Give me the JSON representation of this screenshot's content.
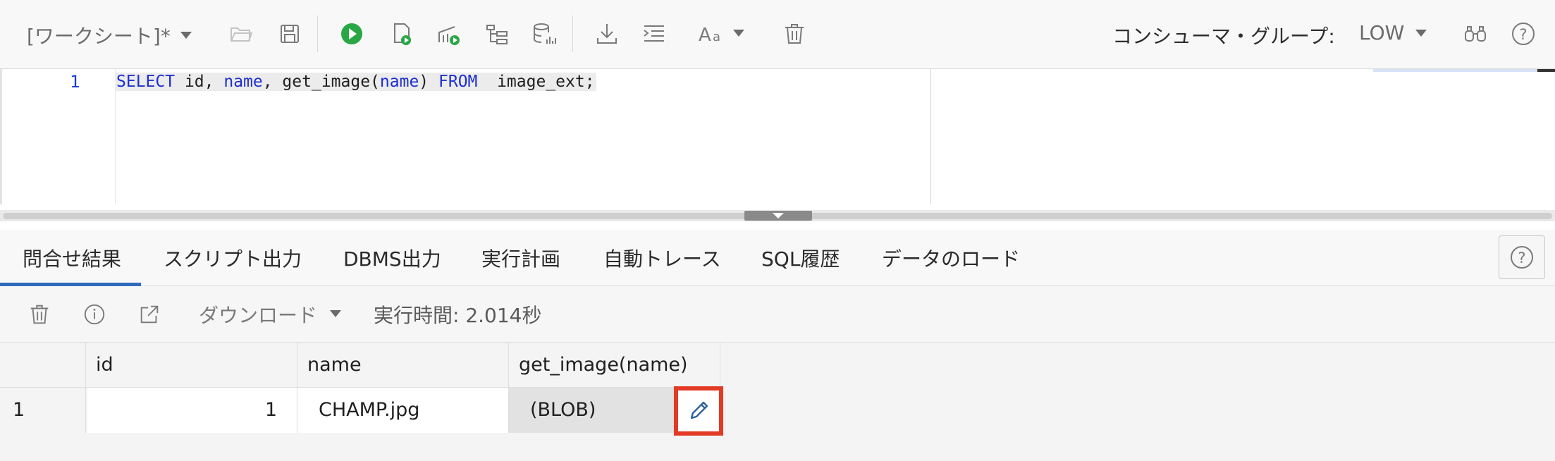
{
  "toolbar": {
    "worksheet_title": "[ワークシート]*",
    "consumer_group_label": "コンシューマ・グループ:",
    "consumer_group_value": "LOW",
    "colors": {
      "run_green": "#2aa745",
      "icon_gray": "#7a7a7a"
    }
  },
  "editor": {
    "line_number": "1",
    "tokens": [
      {
        "t": "SELECT",
        "kw": true
      },
      {
        "t": " id, ",
        "kw": false
      },
      {
        "t": "name",
        "kw": true
      },
      {
        "t": ", get_image(",
        "kw": false
      },
      {
        "t": "name",
        "kw": true
      },
      {
        "t": ") ",
        "kw": false
      },
      {
        "t": "FROM",
        "kw": true
      },
      {
        "t": "  image_ext;",
        "kw": false
      }
    ],
    "colors": {
      "keyword": "#1e2fd0"
    }
  },
  "tabs": [
    {
      "label": "問合せ結果",
      "active": true
    },
    {
      "label": "スクリプト出力",
      "active": false
    },
    {
      "label": "DBMS出力",
      "active": false
    },
    {
      "label": "実行計画",
      "active": false
    },
    {
      "label": "自動トレース",
      "active": false
    },
    {
      "label": "SQL履歴",
      "active": false
    },
    {
      "label": "データのロード",
      "active": false
    }
  ],
  "result_toolbar": {
    "download_label": "ダウンロード",
    "execution_time": "実行時間: 2.014秒"
  },
  "grid": {
    "columns": [
      "id",
      "name",
      "get_image(name)"
    ],
    "rows": [
      {
        "row_number": "1",
        "id": "1",
        "name": "CHAMP.jpg",
        "get_image": "(BLOB)"
      }
    ],
    "highlight_color": "#e23a24"
  }
}
